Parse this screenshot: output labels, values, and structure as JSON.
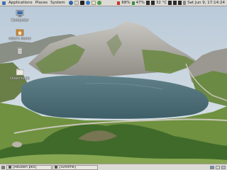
{
  "top_panel": {
    "menus": [
      "Applications",
      "Places",
      "System"
    ],
    "launchers": [
      "browser-icon",
      "mail-icon",
      "terminal-icon",
      "help-icon",
      "editor-icon",
      "chat-icon"
    ],
    "cpu_label": "68%",
    "mem_label": "47%",
    "temp_label": "32 °C",
    "clock": "Sat Jun 9, 17:14:24"
  },
  "desktop": {
    "icons": [
      {
        "name": "computer",
        "label": "Computer"
      },
      {
        "name": "home",
        "label": "rebo's Home"
      },
      {
        "name": "trash",
        "label": ""
      },
      {
        "name": "downloads",
        "label": "Downloads"
      }
    ],
    "wallpaper": "mountain-lake-landscape"
  },
  "bottom_panel": {
    "tasks": [
      {
        "label": "[Reuben pkx]"
      },
      {
        "label": "[Svstime]"
      }
    ]
  },
  "colors": {
    "panel": "#dcdad5",
    "sky": "#c9d7e2",
    "lake": "#4b6d78",
    "grass": "#5c7f36"
  }
}
